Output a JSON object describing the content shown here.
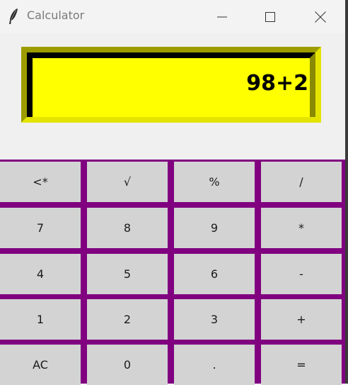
{
  "window": {
    "title": "Calculator"
  },
  "display": {
    "text": "98+2",
    "background_color": "#ffff00"
  },
  "keypad": {
    "background_color": "#800080",
    "rows": [
      [
        "<*",
        "√",
        "%",
        "/"
      ],
      [
        "7",
        "8",
        "9",
        "*"
      ],
      [
        "4",
        "5",
        "6",
        "-"
      ],
      [
        "1",
        "2",
        "3",
        "+"
      ],
      [
        "AC",
        "0",
        ".",
        "="
      ]
    ]
  },
  "icons": {
    "app": "feather-icon",
    "minimize": "minimize-icon",
    "maximize": "maximize-icon",
    "close": "close-icon"
  }
}
